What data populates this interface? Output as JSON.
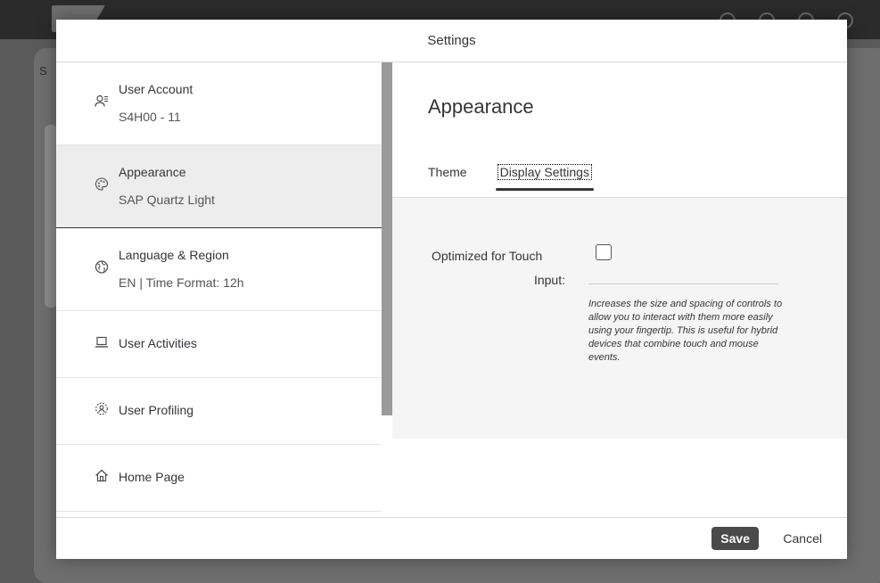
{
  "backdrop": {
    "shell_letter": "S"
  },
  "dialog": {
    "title": "Settings",
    "nav": [
      {
        "title": "User Account",
        "subtitle": "S4H00 - 11",
        "icon": "user-account-icon"
      },
      {
        "title": "Appearance",
        "subtitle": "SAP Quartz Light",
        "icon": "palette-icon"
      },
      {
        "title": "Language & Region",
        "subtitle": "EN | Time Format: 12h",
        "icon": "globe-icon"
      },
      {
        "title": "User Activities",
        "icon": "laptop-icon"
      },
      {
        "title": "User Profiling",
        "icon": "user-settings-icon"
      },
      {
        "title": "Home Page",
        "icon": "home-icon"
      }
    ],
    "section_title": "Appearance",
    "tabs": [
      "Theme",
      "Display Settings"
    ],
    "touch": {
      "label_line1": "Optimized for Touch",
      "label_line2": "Input:",
      "description": "Increases the size and spacing of controls to allow you to interact with them more easily using your fingertip. This is useful for hybrid devices that combine touch and mouse events."
    },
    "footer": {
      "save": "Save",
      "cancel": "Cancel"
    }
  }
}
